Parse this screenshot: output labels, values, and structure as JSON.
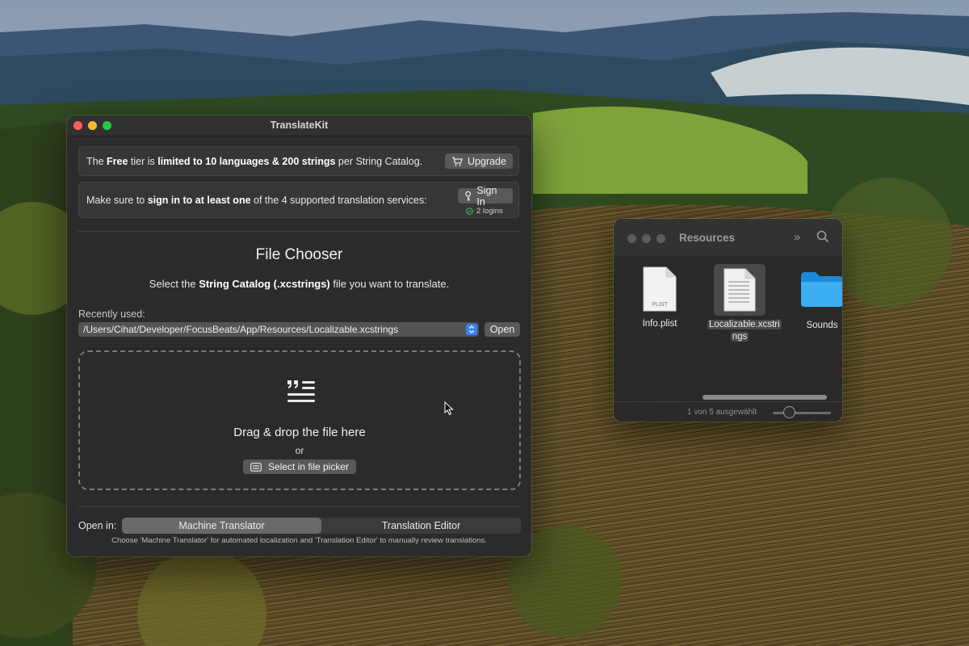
{
  "window": {
    "title": "TranslateKit"
  },
  "tier_banner": {
    "text_1": "The ",
    "text_2": "Free",
    "text_3": " tier is ",
    "text_4": "limited to 10 languages & 200 strings",
    "text_5": " per String Catalog.",
    "button_label": "Upgrade"
  },
  "signin_banner": {
    "text_1": "Make sure to ",
    "text_2": "sign in to at least one",
    "text_3": " of the 4 supported translation services:",
    "button_label": "Sign In",
    "status": "2 logins"
  },
  "file_chooser": {
    "title": "File Chooser",
    "subtitle_1": "Select the ",
    "subtitle_2": "String Catalog (.xcstrings)",
    "subtitle_3": " file you want to translate.",
    "recent_label": "Recently used:",
    "recent_value": "/Users/Cihat/Developer/FocusBeats/App/Resources/Localizable.xcstrings",
    "open_label": "Open"
  },
  "dropzone": {
    "title": "Drag & drop the file here",
    "or": "or",
    "picker_label": "Select in file picker"
  },
  "open_in": {
    "label": "Open in:",
    "options": [
      "Machine Translator",
      "Translation Editor"
    ],
    "selected": "Machine Translator",
    "hint": "Choose 'Machine Translator' for automated localization and 'Translation Editor' to manually review translations."
  },
  "finder": {
    "title": "Resources",
    "files": [
      {
        "name": "Info.plist",
        "badge": "PLIST"
      },
      {
        "name_line1": "Localizable.xcstri",
        "name_line2": "ngs"
      },
      {
        "name": "Sounds"
      }
    ],
    "status": "1 von 5 ausgewählt"
  },
  "colors": {
    "window_bg": "#2c2b2b",
    "button_bg": "#5a5959",
    "accent_blue": "#3b82f6",
    "folder_blue": "#2fa4f0"
  }
}
